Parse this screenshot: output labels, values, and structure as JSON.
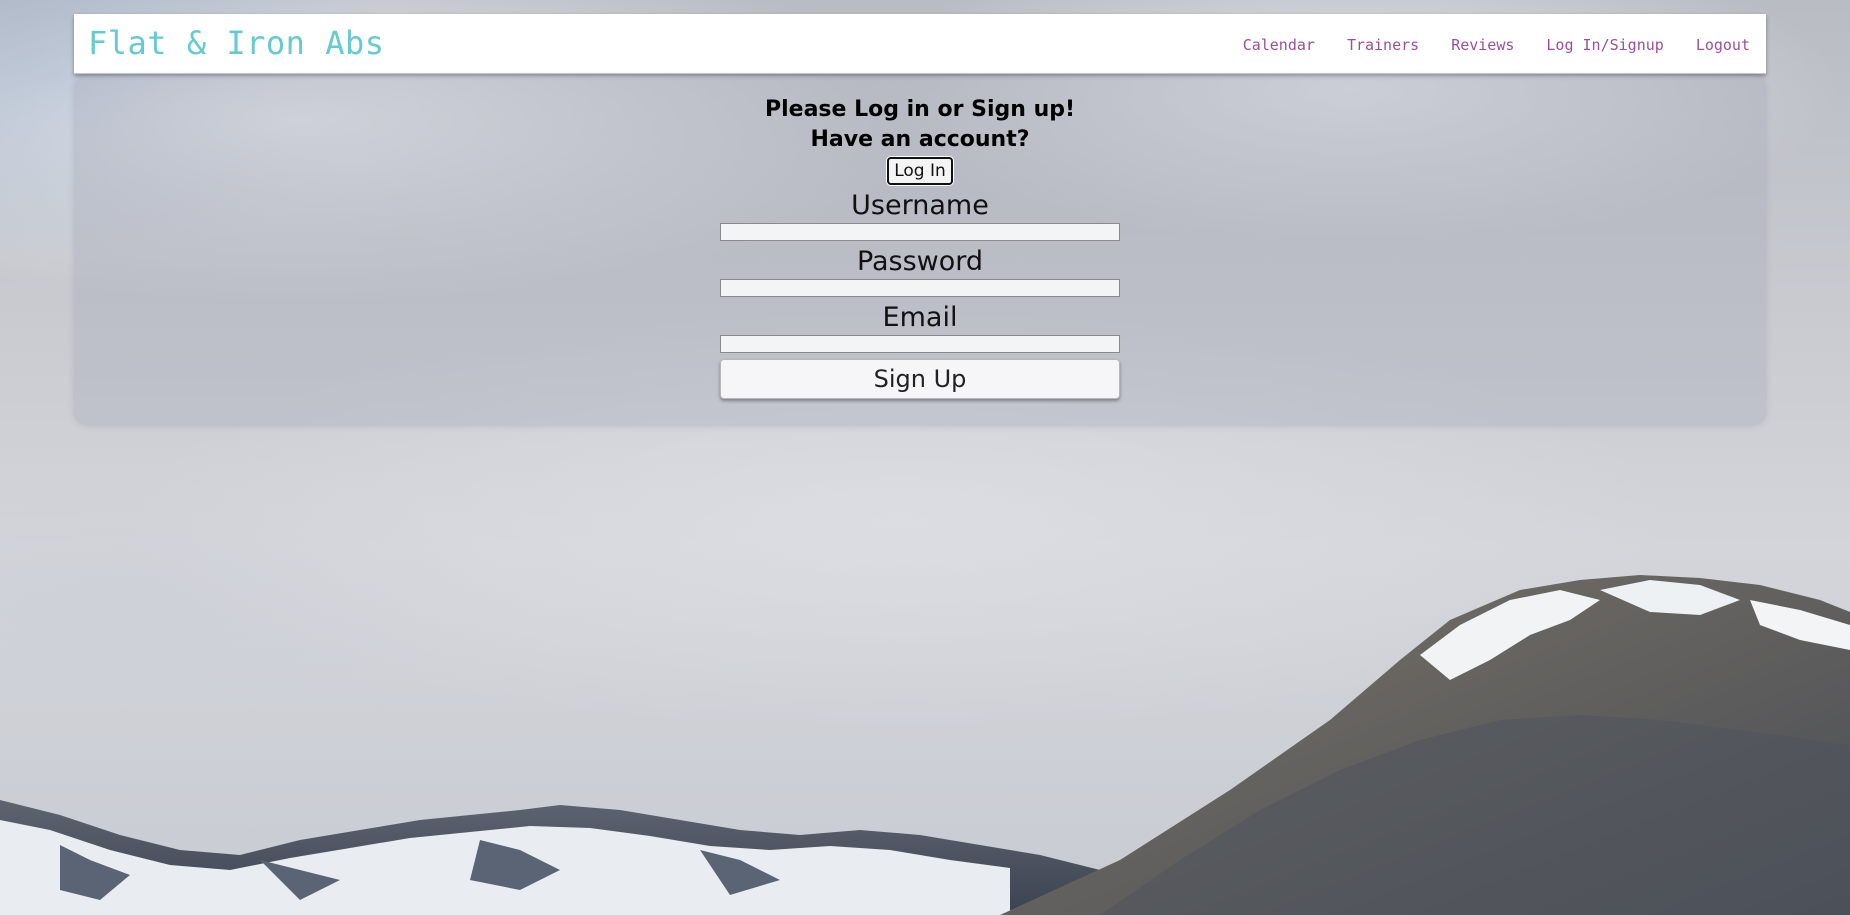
{
  "nav": {
    "brand": "Flat & Iron Abs",
    "links": [
      "Calendar",
      "Trainers",
      "Reviews",
      "Log In/Signup",
      "Logout"
    ]
  },
  "form": {
    "heading": "Please Log in or Sign up!",
    "subheading": "Have an account?",
    "login_button": "Log In",
    "username_label": "Username",
    "username_value": "",
    "password_label": "Password",
    "password_value": "",
    "email_label": "Email",
    "email_value": "",
    "signup_button": "Sign Up"
  },
  "colors": {
    "brand": "#64cbd2",
    "nav_link": "#9c4f98"
  }
}
